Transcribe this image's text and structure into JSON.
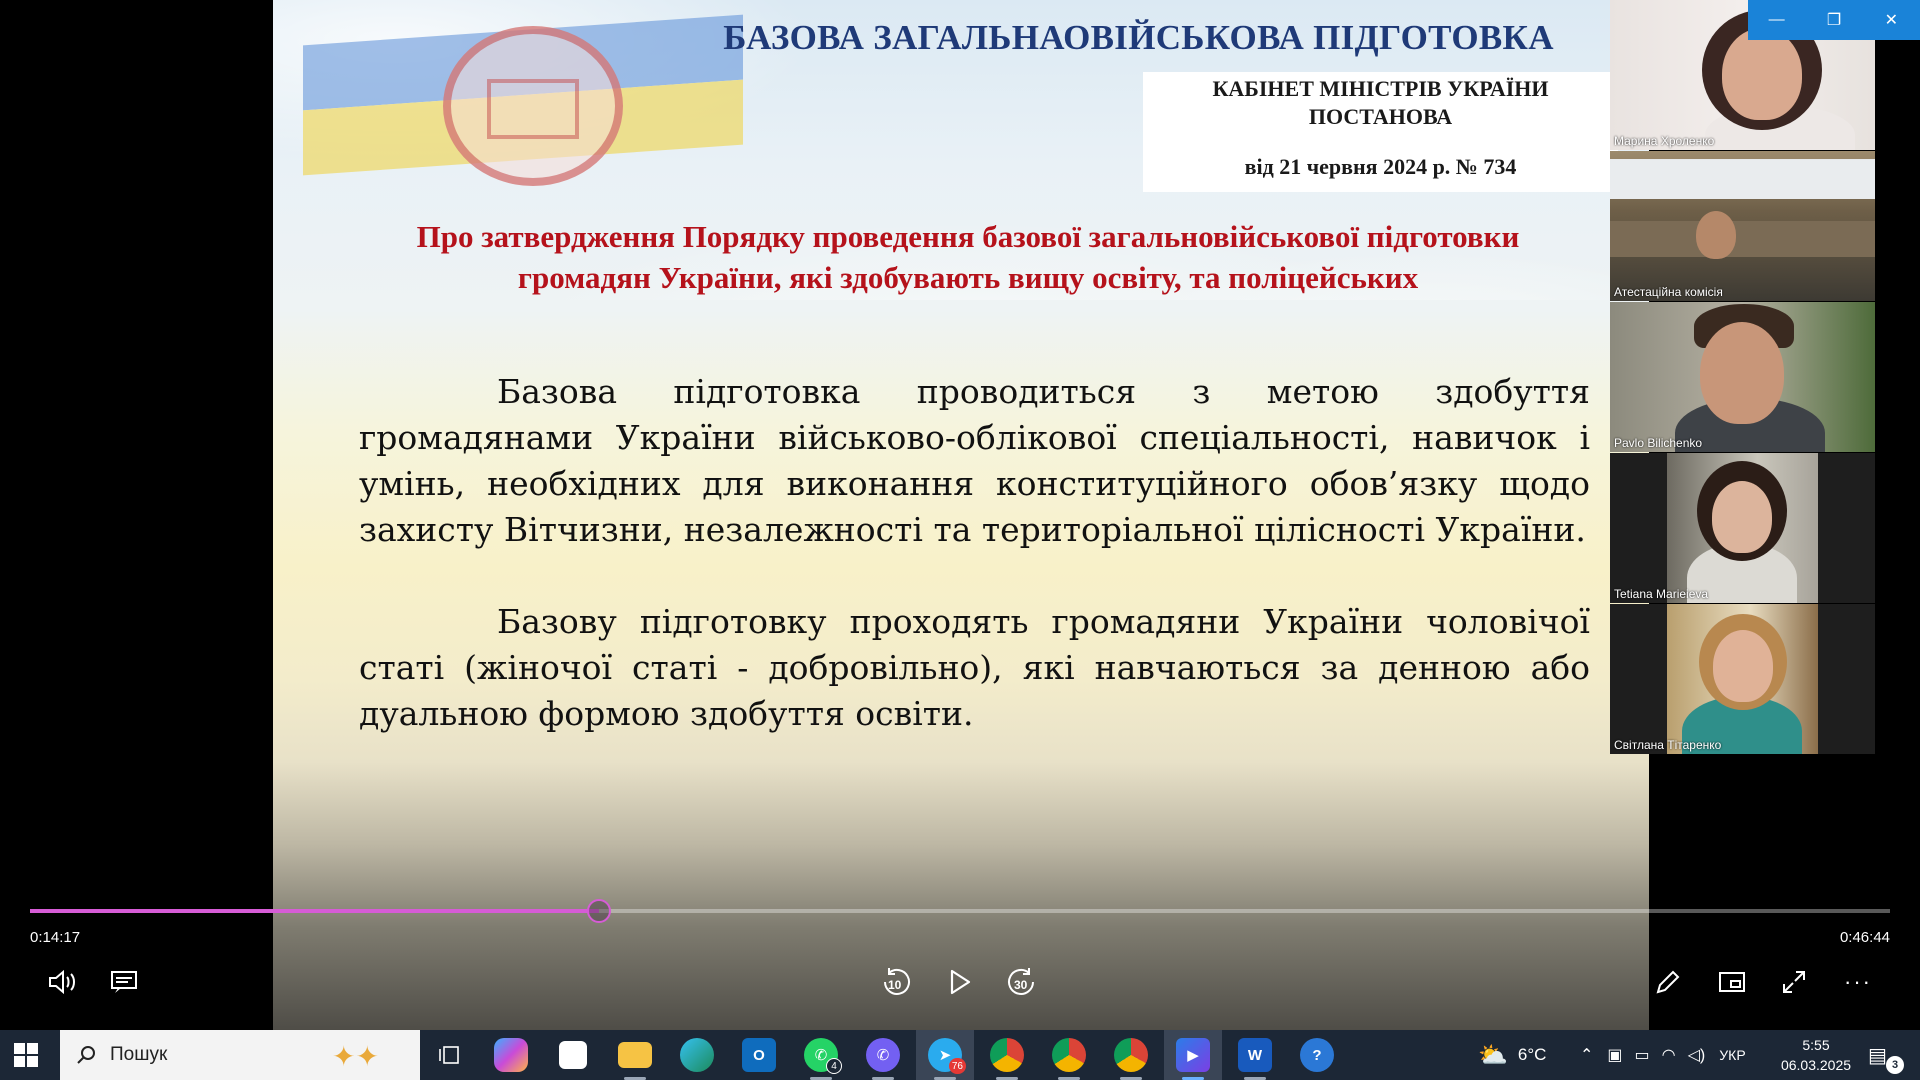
{
  "slide": {
    "title": "БАЗОВА ЗАГАЛЬНАОВІЙСЬКОВА ПІДГОТОВКА",
    "doc_line1": "КАБІНЕТ МІНІСТРІВ УКРАЇНИ",
    "doc_line2": "ПОСТАНОВА",
    "doc_date": "від 21 червня 2024 р. № 734",
    "subtitle": "Про затвердження Порядку проведення базової загальновійськової підготовки громадян України, які здобувають вищу освіту, та поліцейських",
    "paragraph1": "Базова підготовка проводиться з метою здобуття громадянами України військово-облікової спеціальності, навичок і умінь, необхідних для виконання конституційного обов’язку щодо захисту Вітчизни, незалежності та територіальної цілісності України.",
    "paragraph2": "Базову підготовку проходять громадяни України чоловічої статі (жіночої статі - добровільно), які навчаються за денною або дуальною формою здобуття освіти."
  },
  "participants": [
    {
      "name": "Марина Хроленко"
    },
    {
      "name": "Атестаційна комісія"
    },
    {
      "name": "Pavlo Bilichenko"
    },
    {
      "name": "Tetiana Marieieva"
    },
    {
      "name": "Світлана Тітаренко"
    }
  ],
  "window_controls": {
    "minimize": "—",
    "restore": "❐",
    "close": "✕"
  },
  "player": {
    "elapsed": "0:14:17",
    "total": "0:46:44",
    "progress_fraction": 0.306,
    "skip_back": "10",
    "skip_forward": "30",
    "accent": "#d65cd6"
  },
  "taskbar": {
    "search_placeholder": "Пошук",
    "whatsapp_badge": "4",
    "telegram_badge": "76",
    "weather_temp": "6°C",
    "language": "УКР",
    "time": "5:55",
    "date": "06.03.2025",
    "notifications": "3"
  }
}
